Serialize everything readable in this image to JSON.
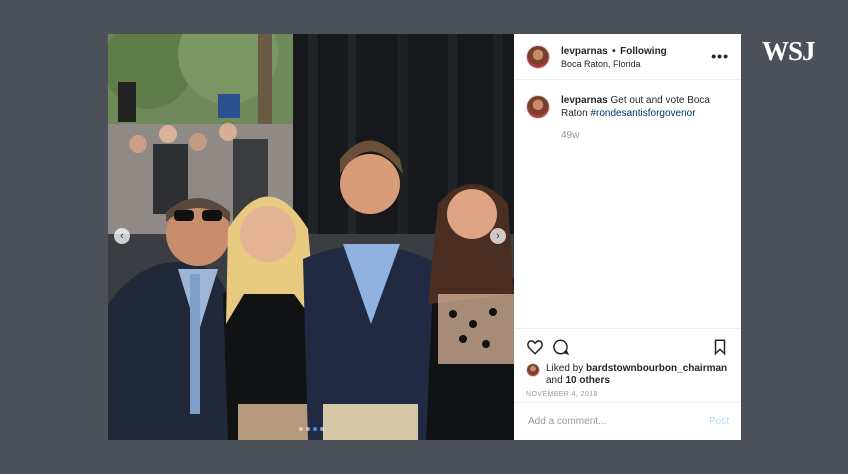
{
  "brand": {
    "logo_text": "WSJ"
  },
  "post": {
    "username": "levparnas",
    "follow_label": "Following",
    "separator": "•",
    "location": "Boca Raton, Florida",
    "more_label": "•••",
    "caption": {
      "username": "levparnas",
      "text": "Get out and vote Boca Raton",
      "hashtag": "#rondesantisforgovenor",
      "age": "49w"
    },
    "likes": {
      "prefix": "Liked by",
      "liker": "bardstownbourbon_chairman",
      "and": "and",
      "others": "10 others"
    },
    "date": "NOVEMBER 4, 2018",
    "comment_input": {
      "placeholder": "Add a comment...",
      "value": ""
    },
    "post_button": "Post",
    "carousel": {
      "total": 4,
      "active": 2
    },
    "icons": {
      "like": "heart-icon",
      "comment": "comment-icon",
      "save": "bookmark-icon",
      "prev": "chevron-left-icon",
      "next": "chevron-right-icon"
    }
  },
  "colors": {
    "background": "#4b5059",
    "link": "#003569",
    "muted": "#999999",
    "post_disabled": "#b2dffc",
    "active_dot": "#3897f0"
  }
}
